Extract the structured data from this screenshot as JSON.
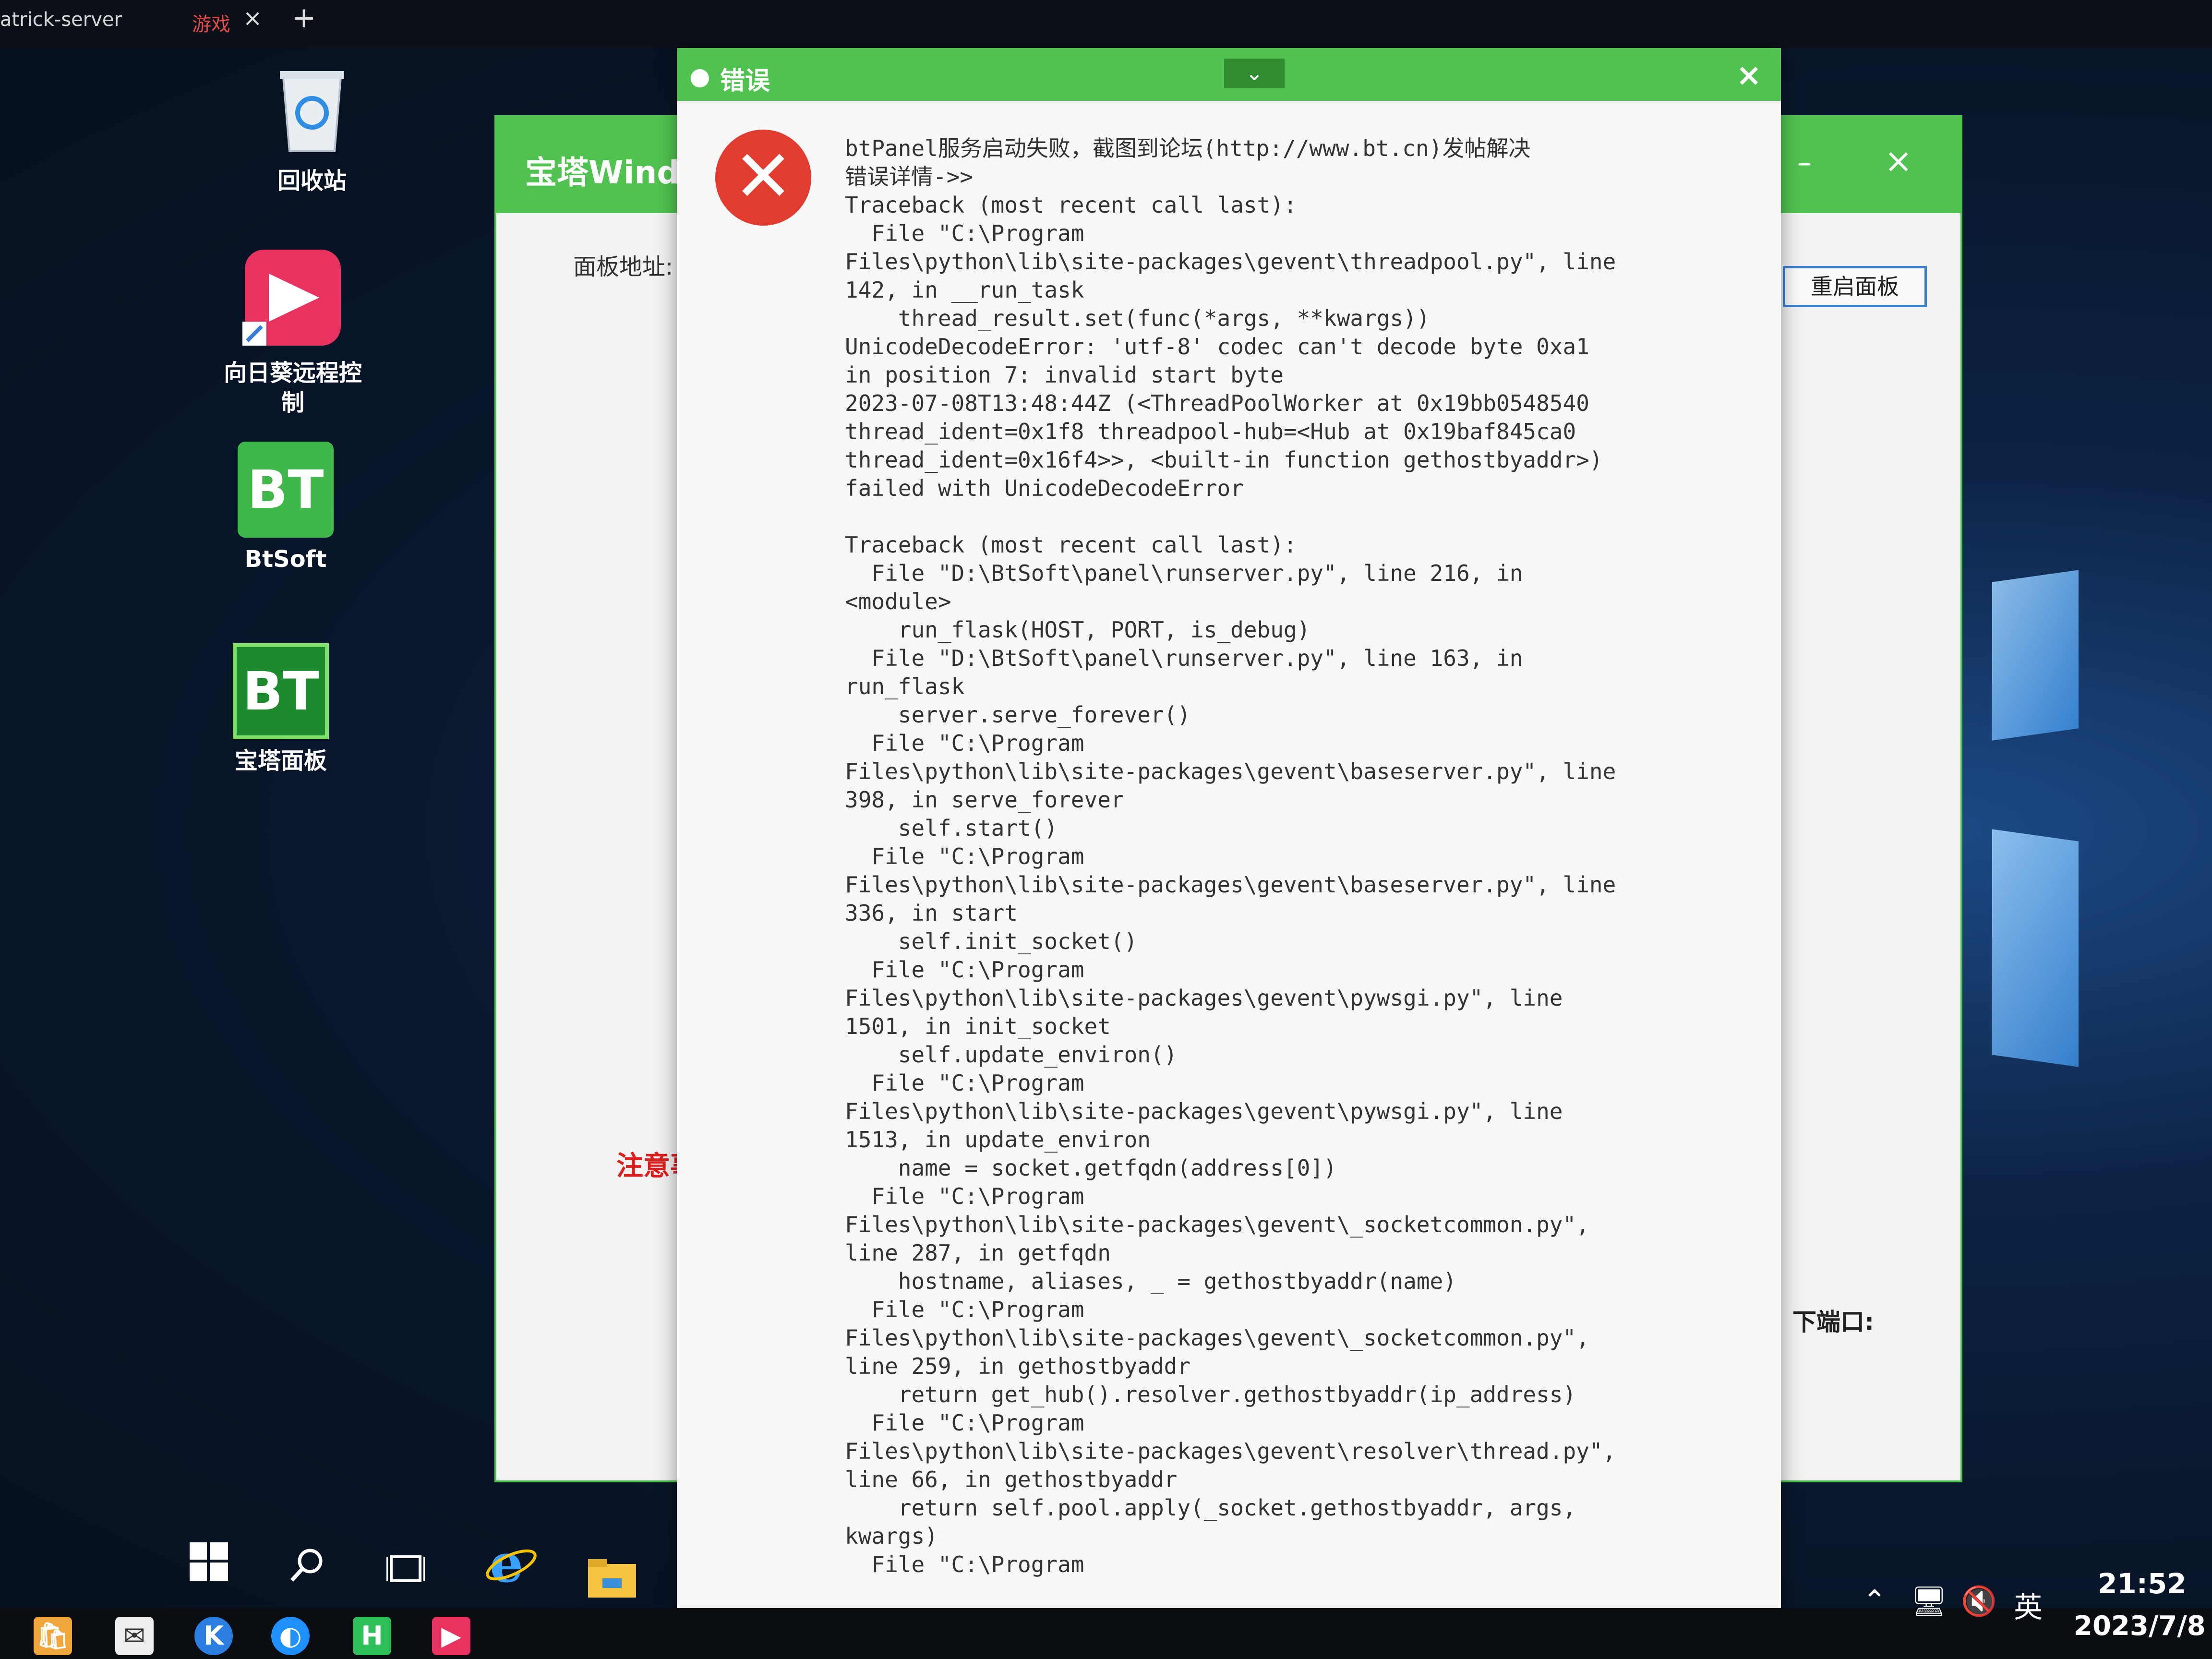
{
  "tabs": {
    "server": "atrick-server",
    "games": "游戏",
    "close": "×",
    "add": "+"
  },
  "desktop": {
    "icons": [
      {
        "label": "回收站"
      },
      {
        "label": "向日葵远程控制"
      },
      {
        "label": "BtSoft",
        "badge": "BT"
      },
      {
        "label": "宝塔面板",
        "badge": "BT"
      }
    ]
  },
  "bg_window": {
    "title": "宝塔Windo",
    "minimize": "–",
    "close": "×",
    "panel_address_label": "面板地址:",
    "restart_button": "重启面板",
    "note_label": "注意事",
    "port_label": "下端口:"
  },
  "error_dialog": {
    "title": "错误",
    "collapse": "⌄",
    "close": "×",
    "icon": "✕",
    "message": "btPanel服务启动失败，截图到论坛(http://www.bt.cn)发帖解决\n错误详情->>\nTraceback (most recent call last):\n  File \"C:\\Program\nFiles\\python\\lib\\site-packages\\gevent\\threadpool.py\", line\n142, in __run_task\n    thread_result.set(func(*args, **kwargs))\nUnicodeDecodeError: 'utf-8' codec can't decode byte 0xa1\nin position 7: invalid start byte\n2023-07-08T13:48:44Z (<ThreadPoolWorker at 0x19bb0548540\nthread_ident=0x1f8 threadpool-hub=<Hub at 0x19baf845ca0\nthread_ident=0x16f4>>, <built-in function gethostbyaddr>)\nfailed with UnicodeDecodeError\n\nTraceback (most recent call last):\n  File \"D:\\BtSoft\\panel\\runserver.py\", line 216, in\n<module>\n    run_flask(HOST, PORT, is_debug)\n  File \"D:\\BtSoft\\panel\\runserver.py\", line 163, in\nrun_flask\n    server.serve_forever()\n  File \"C:\\Program\nFiles\\python\\lib\\site-packages\\gevent\\baseserver.py\", line\n398, in serve_forever\n    self.start()\n  File \"C:\\Program\nFiles\\python\\lib\\site-packages\\gevent\\baseserver.py\", line\n336, in start\n    self.init_socket()\n  File \"C:\\Program\nFiles\\python\\lib\\site-packages\\gevent\\pywsgi.py\", line\n1501, in init_socket\n    self.update_environ()\n  File \"C:\\Program\nFiles\\python\\lib\\site-packages\\gevent\\pywsgi.py\", line\n1513, in update_environ\n    name = socket.getfqdn(address[0])\n  File \"C:\\Program\nFiles\\python\\lib\\site-packages\\gevent\\_socketcommon.py\",\nline 287, in getfqdn\n    hostname, aliases, _ = gethostbyaddr(name)\n  File \"C:\\Program\nFiles\\python\\lib\\site-packages\\gevent\\_socketcommon.py\",\nline 259, in gethostbyaddr\n    return get_hub().resolver.gethostbyaddr(ip_address)\n  File \"C:\\Program\nFiles\\python\\lib\\site-packages\\gevent\\resolver\\thread.py\",\nline 66, in gethostbyaddr\n    return self.pool.apply(_socket.gethostbyaddr, args,\nkwargs)\n  File \"C:\\Program"
  },
  "taskbar": {
    "tray_ime": "英",
    "time": "21:52",
    "date": "2023/7/8",
    "pinned_h": "H",
    "pinned_k": "K"
  },
  "colors": {
    "accent_green": "#4fc24f",
    "error_red": "#e23b30",
    "link_blue": "#3e7fcc"
  }
}
